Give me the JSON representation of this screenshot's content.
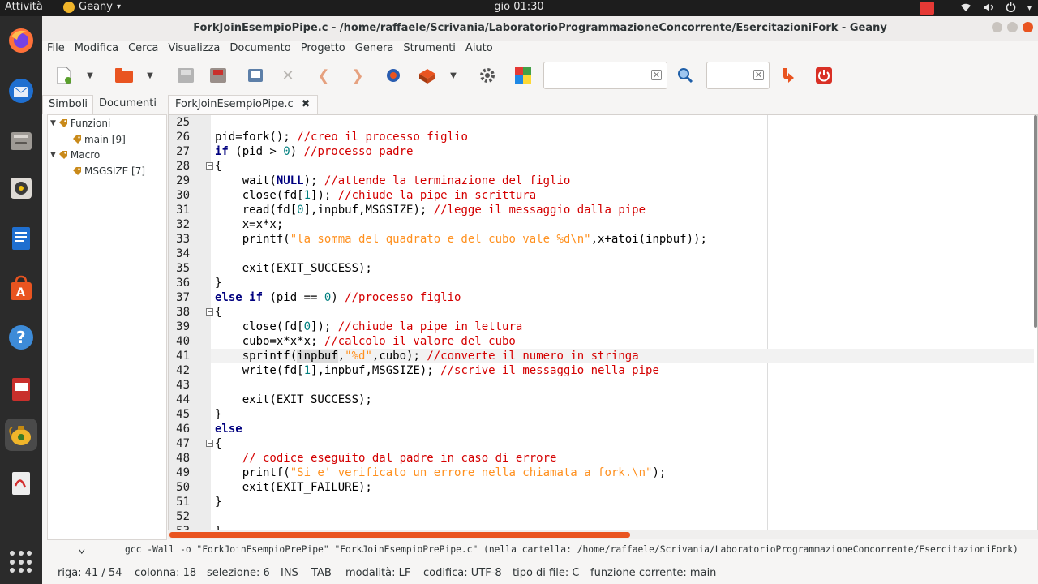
{
  "topbar": {
    "activities": "Attività",
    "app_name": "Geany",
    "clock": "gio 01:30"
  },
  "window": {
    "title": "ForkJoinEsempioPipe.c - /home/raffaele/Scrivania/LaboratorioProgrammazioneConcorrente/EsercitazioniFork - Geany"
  },
  "menu": [
    "File",
    "Modifica",
    "Cerca",
    "Visualizza",
    "Documento",
    "Progetto",
    "Genera",
    "Strumenti",
    "Aiuto"
  ],
  "sidebar": {
    "tabs": [
      "Simboli",
      "Documenti"
    ],
    "tree": {
      "functions": "Funzioni",
      "main": "main [9]",
      "macros": "Macro",
      "msgsize": "MSGSIZE [7]"
    }
  },
  "editor": {
    "tab_label": "ForkJoinEsempioPipe.c",
    "lines": [
      {
        "n": "25",
        "parts": [
          {
            "t": ""
          }
        ]
      },
      {
        "n": "26",
        "parts": [
          {
            "t": "pid=fork(); "
          },
          {
            "t": "//creo il processo figlio",
            "c": "cm"
          }
        ]
      },
      {
        "n": "27",
        "parts": [
          {
            "t": "if",
            "c": "kw"
          },
          {
            "t": " (pid > "
          },
          {
            "t": "0",
            "c": "nm"
          },
          {
            "t": ") "
          },
          {
            "t": "//processo padre",
            "c": "cm"
          }
        ]
      },
      {
        "n": "28",
        "parts": [
          {
            "t": "{"
          }
        ],
        "fold": true
      },
      {
        "n": "29",
        "parts": [
          {
            "t": "    wait("
          },
          {
            "t": "NULL",
            "c": "kw"
          },
          {
            "t": "); "
          },
          {
            "t": "//attende la terminazione del figlio",
            "c": "cm"
          }
        ]
      },
      {
        "n": "30",
        "parts": [
          {
            "t": "    close(fd["
          },
          {
            "t": "1",
            "c": "nm"
          },
          {
            "t": "]); "
          },
          {
            "t": "//chiude la pipe in scrittura",
            "c": "cm"
          }
        ]
      },
      {
        "n": "31",
        "parts": [
          {
            "t": "    read(fd["
          },
          {
            "t": "0",
            "c": "nm"
          },
          {
            "t": "],inpbuf,MSGSIZE); "
          },
          {
            "t": "//legge il messaggio dalla pipe",
            "c": "cm"
          }
        ]
      },
      {
        "n": "32",
        "parts": [
          {
            "t": "    x=x*x;"
          }
        ]
      },
      {
        "n": "33",
        "parts": [
          {
            "t": "    printf("
          },
          {
            "t": "\"la somma del quadrato e del cubo vale %d\\n\"",
            "c": "st"
          },
          {
            "t": ",x+atoi(inpbuf));"
          }
        ]
      },
      {
        "n": "34",
        "parts": [
          {
            "t": ""
          }
        ]
      },
      {
        "n": "35",
        "parts": [
          {
            "t": "    exit(EXIT_SUCCESS);"
          }
        ]
      },
      {
        "n": "36",
        "parts": [
          {
            "t": "}"
          }
        ]
      },
      {
        "n": "37",
        "parts": [
          {
            "t": "else if",
            "c": "kw"
          },
          {
            "t": " (pid == "
          },
          {
            "t": "0",
            "c": "nm"
          },
          {
            "t": ") "
          },
          {
            "t": "//processo figlio",
            "c": "cm"
          }
        ]
      },
      {
        "n": "38",
        "parts": [
          {
            "t": "{"
          }
        ],
        "fold": true
      },
      {
        "n": "39",
        "parts": [
          {
            "t": "    close(fd["
          },
          {
            "t": "0",
            "c": "nm"
          },
          {
            "t": "]); "
          },
          {
            "t": "//chiude la pipe in lettura",
            "c": "cm"
          }
        ]
      },
      {
        "n": "40",
        "parts": [
          {
            "t": "    cubo=x*x*x; "
          },
          {
            "t": "//calcolo il valore del cubo",
            "c": "cm"
          }
        ]
      },
      {
        "n": "41",
        "parts": [
          {
            "t": "    sprintf("
          },
          {
            "t": "inpbuf",
            "c": "hl"
          },
          {
            "t": ","
          },
          {
            "t": "\"%d\"",
            "c": "st"
          },
          {
            "t": ",cubo); "
          },
          {
            "t": "//converte il numero in stringa",
            "c": "cm"
          }
        ],
        "current": true
      },
      {
        "n": "42",
        "parts": [
          {
            "t": "    write(fd["
          },
          {
            "t": "1",
            "c": "nm"
          },
          {
            "t": "],inpbuf,MSGSIZE); "
          },
          {
            "t": "//scrive il messaggio nella pipe",
            "c": "cm"
          }
        ]
      },
      {
        "n": "43",
        "parts": [
          {
            "t": ""
          }
        ]
      },
      {
        "n": "44",
        "parts": [
          {
            "t": "    exit(EXIT_SUCCESS);"
          }
        ]
      },
      {
        "n": "45",
        "parts": [
          {
            "t": "}"
          }
        ]
      },
      {
        "n": "46",
        "parts": [
          {
            "t": "else",
            "c": "kw"
          }
        ]
      },
      {
        "n": "47",
        "parts": [
          {
            "t": "{"
          }
        ],
        "fold": true
      },
      {
        "n": "48",
        "parts": [
          {
            "t": "    "
          },
          {
            "t": "// codice eseguito dal padre in caso di errore",
            "c": "cm"
          }
        ]
      },
      {
        "n": "49",
        "parts": [
          {
            "t": "    printf("
          },
          {
            "t": "\"Si e' verificato un errore nella chiamata a fork.\\n\"",
            "c": "st"
          },
          {
            "t": ");"
          }
        ]
      },
      {
        "n": "50",
        "parts": [
          {
            "t": "    exit(EXIT_FAILURE);"
          }
        ]
      },
      {
        "n": "51",
        "parts": [
          {
            "t": "}"
          }
        ]
      },
      {
        "n": "52",
        "parts": [
          {
            "t": ""
          }
        ]
      },
      {
        "n": "53",
        "parts": [
          {
            "t": "}"
          }
        ]
      }
    ]
  },
  "message": "gcc -Wall -o \"ForkJoinEsempioPrePipe\" \"ForkJoinEsempioPrePipe.c\" (nella cartella: /home/raffaele/Scrivania/LaboratorioProgrammazioneConcorrente/EsercitazioniFork)",
  "status": {
    "line": "riga: 41 / 54",
    "col": "colonna: 18",
    "sel": "selezione: 6",
    "ins": "INS",
    "tab": "TAB",
    "mode": "modalità: LF",
    "enc": "codifica: UTF-8",
    "ftype": "tipo di file: C",
    "func": "funzione corrente: main"
  },
  "colors": {
    "accent": "#e95420",
    "comment": "#d40000",
    "keyword": "#00007f",
    "number": "#007f7f",
    "string": "#ff901e"
  }
}
